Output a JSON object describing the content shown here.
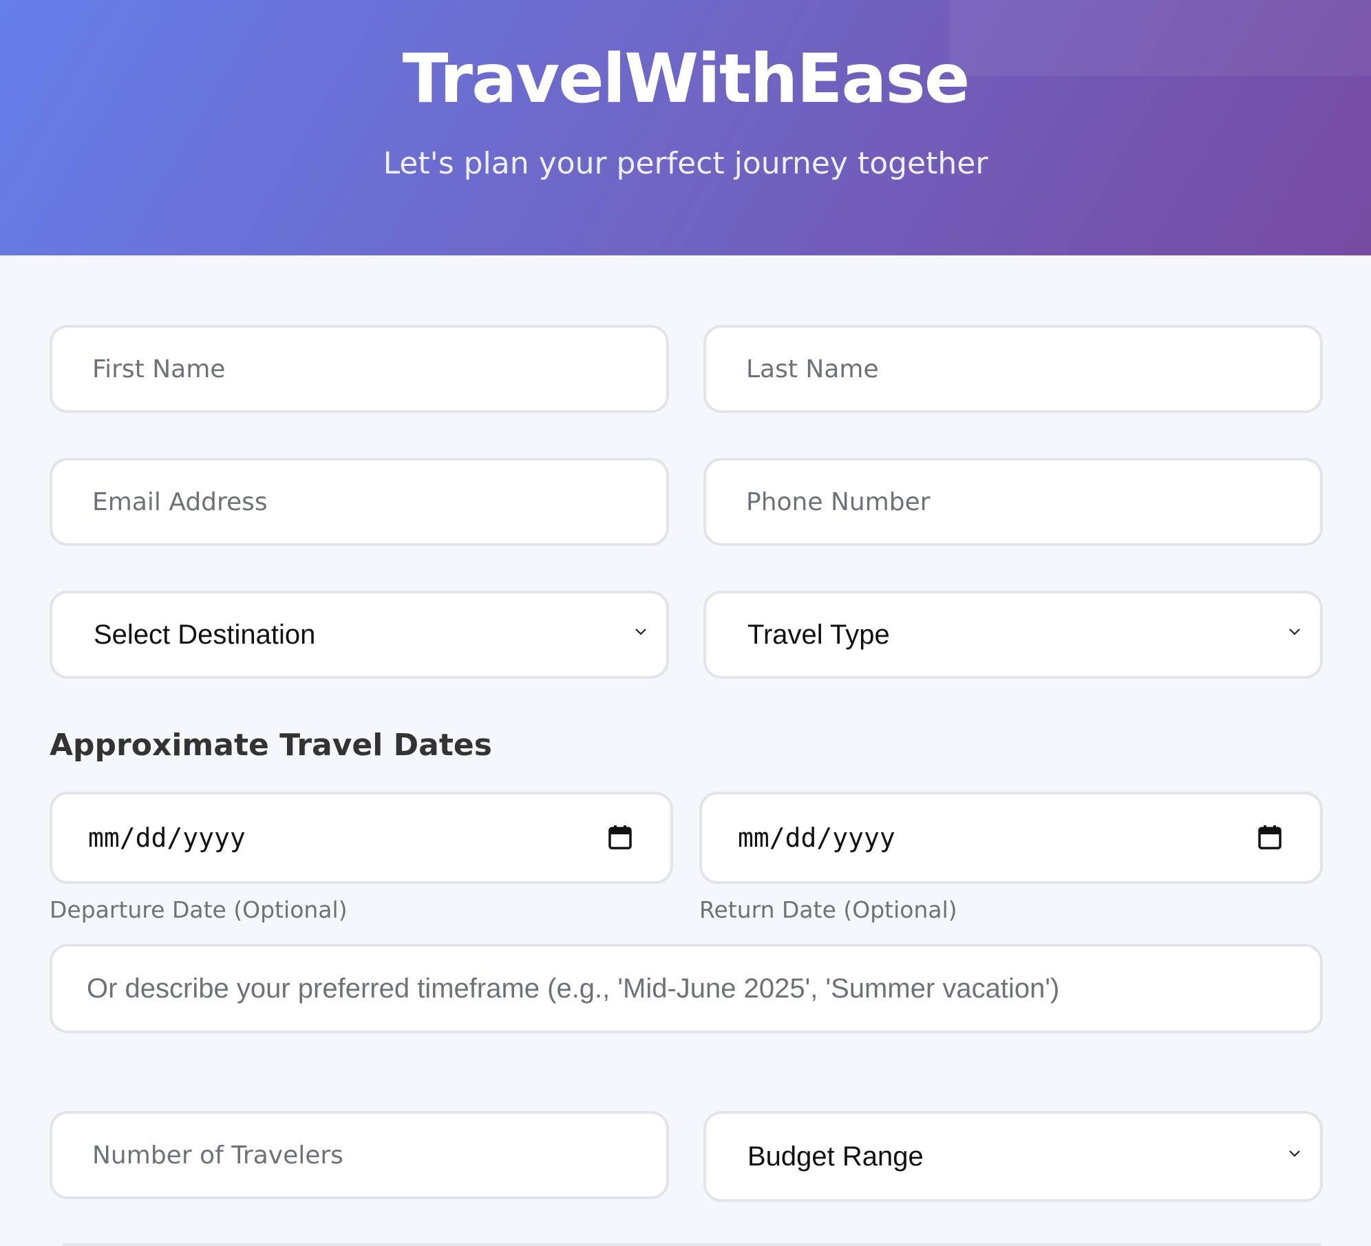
{
  "header": {
    "brand": "TravelWithEase",
    "tagline": "Let's plan your perfect journey together"
  },
  "form": {
    "first_name": {
      "placeholder": "First Name"
    },
    "last_name": {
      "placeholder": "Last Name"
    },
    "email": {
      "placeholder": "Email Address"
    },
    "phone": {
      "placeholder": "Phone Number"
    },
    "destination": {
      "selected": "Select Destination"
    },
    "travel_type": {
      "selected": "Travel Type"
    },
    "dates_section_title": "Approximate Travel Dates",
    "departure": {
      "value": "mm/dd/yyyy",
      "label": "Departure Date (Optional)"
    },
    "return": {
      "value": "mm/dd/yyyy",
      "label": "Return Date (Optional)"
    },
    "timeframe": {
      "placeholder": "Or describe your preferred timeframe (e.g., 'Mid-June 2025', 'Summer vacation')"
    },
    "travelers": {
      "placeholder": "Number of Travelers"
    },
    "budget": {
      "selected": "Budget Range"
    }
  },
  "theme": {
    "gradient_start": "#667eea",
    "gradient_end": "#764ba2",
    "field_border": "#e2e4ea",
    "page_background": "#f6f7fb"
  },
  "icons": {
    "select_arrow": "chevron-down-icon",
    "date_picker": "calendar-icon"
  }
}
